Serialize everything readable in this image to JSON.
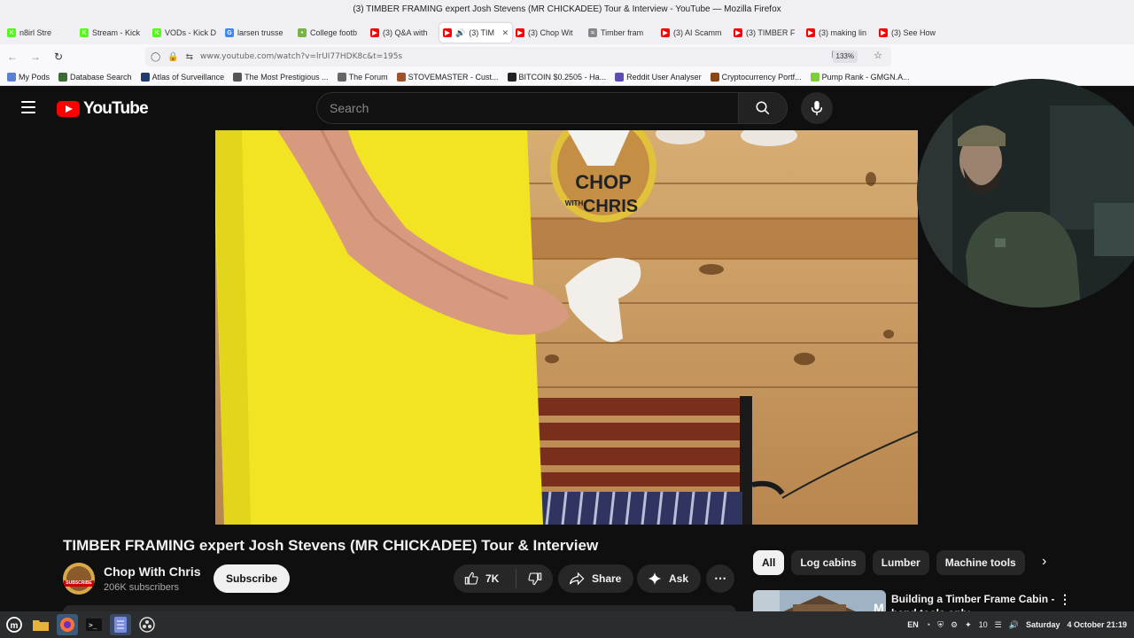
{
  "window": {
    "title": "(3) TIMBER FRAMING expert Josh Stevens (MR CHICKADEE) Tour & Interview - YouTube — Mozilla Firefox"
  },
  "tabs": [
    {
      "label": "n8irl Stre",
      "color": "#53fc18",
      "glyph": "K"
    },
    {
      "label": "Stream - Kick",
      "color": "#53fc18",
      "glyph": "K"
    },
    {
      "label": "VODs - Kick D",
      "color": "#53fc18",
      "glyph": "K"
    },
    {
      "label": "larsen trusse",
      "color": "#4285f4",
      "glyph": "G"
    },
    {
      "label": "College footb",
      "color": "#7cb342",
      "glyph": "•"
    },
    {
      "label": "(3) Q&A with",
      "color": "#ff0000",
      "glyph": "▶"
    },
    {
      "label": "(3) TIM",
      "color": "#ff0000",
      "glyph": "▶",
      "active": true
    },
    {
      "label": "(3) Chop Wit",
      "color": "#ff0000",
      "glyph": "▶"
    },
    {
      "label": "Timber fram",
      "color": "#888888",
      "glyph": "≈"
    },
    {
      "label": "(3) AI Scamm",
      "color": "#ff0000",
      "glyph": "▶"
    },
    {
      "label": "(3) TIMBER F",
      "color": "#ff0000",
      "glyph": "▶"
    },
    {
      "label": "(3) making lin",
      "color": "#ff0000",
      "glyph": "▶"
    },
    {
      "label": "(3) See How",
      "color": "#ff0000",
      "glyph": "▶"
    }
  ],
  "nav": {
    "url": "www.youtube.com/watch?v=lrUI77HDK8c&t=195s",
    "zoom": "133%"
  },
  "bookmarks": [
    {
      "label": "My Pods",
      "color": "#5a7fd8"
    },
    {
      "label": "Database Search",
      "color": "#3d6b35"
    },
    {
      "label": "Atlas of Surveillance",
      "color": "#1f3b70"
    },
    {
      "label": "The Most Prestigious ...",
      "color": "#555555"
    },
    {
      "label": "The Forum",
      "color": "#666666"
    },
    {
      "label": "STOVEMASTER - Cust...",
      "color": "#a0522d"
    },
    {
      "label": "BITCOIN $0.2505 - Ha...",
      "color": "#222222"
    },
    {
      "label": "Reddit User Analyser",
      "color": "#5e4db2"
    },
    {
      "label": "Cryptocurrency Portf...",
      "color": "#8b4513"
    },
    {
      "label": "Pump Rank - GMGN.A...",
      "color": "#7ccf3a"
    }
  ],
  "youtube": {
    "logo_text": "YouTube",
    "search_placeholder": "Search",
    "video_title": "TIMBER FRAMING expert Josh Stevens (MR CHICKADEE) Tour & Interview",
    "channel": {
      "name": "Chop With Chris",
      "subscribers": "206K subscribers",
      "avatar_badge": "SUBSCRIBE"
    },
    "subscribe_label": "Subscribe",
    "likes": "7K",
    "share_label": "Share",
    "ask_label": "Ask",
    "video_sign": {
      "line1": "CHOP",
      "line2": "WITH",
      "line3": "CHRIS"
    },
    "chips": [
      {
        "label": "All",
        "active": true
      },
      {
        "label": "Log cabins"
      },
      {
        "label": "Lumber"
      },
      {
        "label": "Machine tools"
      }
    ],
    "recommendation": {
      "title": "Building a Timber Frame Cabin - hand tools only"
    }
  },
  "taskbar": {
    "tray": {
      "lang": "EN",
      "volume_level": "10",
      "day": "Saturday",
      "datetime": "4 October 21:19"
    }
  },
  "colors": {
    "yt_red": "#ff0000",
    "bg": "#0f0f0f",
    "shirt_yellow": "#f5e625",
    "wood": "#c89a5e"
  }
}
